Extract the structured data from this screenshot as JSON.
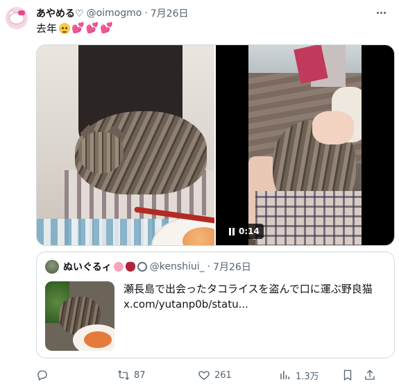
{
  "tweet": {
    "display_name": "あやめる♡",
    "handle": "@oimogmo",
    "separator": "·",
    "date": "7月26日",
    "text": "去年"
  },
  "media": {
    "video_duration": "0:14"
  },
  "quote": {
    "display_name": "ぬいぐるィ",
    "handle": "@kenshiui_",
    "separator": "·",
    "date": "7月26日",
    "text_line1": "瀬長島で出会ったタコライスを盗んで口に運ぶ野良猫",
    "text_line2": "x.com/yutanp0b/statu..."
  },
  "actions": {
    "replies": "",
    "retweets": "87",
    "likes": "261",
    "views": "1.3万"
  },
  "colors": {
    "text_primary": "#0f1419",
    "text_secondary": "#536471",
    "border": "#cfd9de",
    "heart": "#d01f45"
  },
  "icons": [
    "hello-kitty-avatar",
    "more-icon",
    "pause-icon",
    "reply-icon",
    "retweet-icon",
    "like-icon",
    "views-icon",
    "bookmark-icon",
    "share-icon"
  ]
}
